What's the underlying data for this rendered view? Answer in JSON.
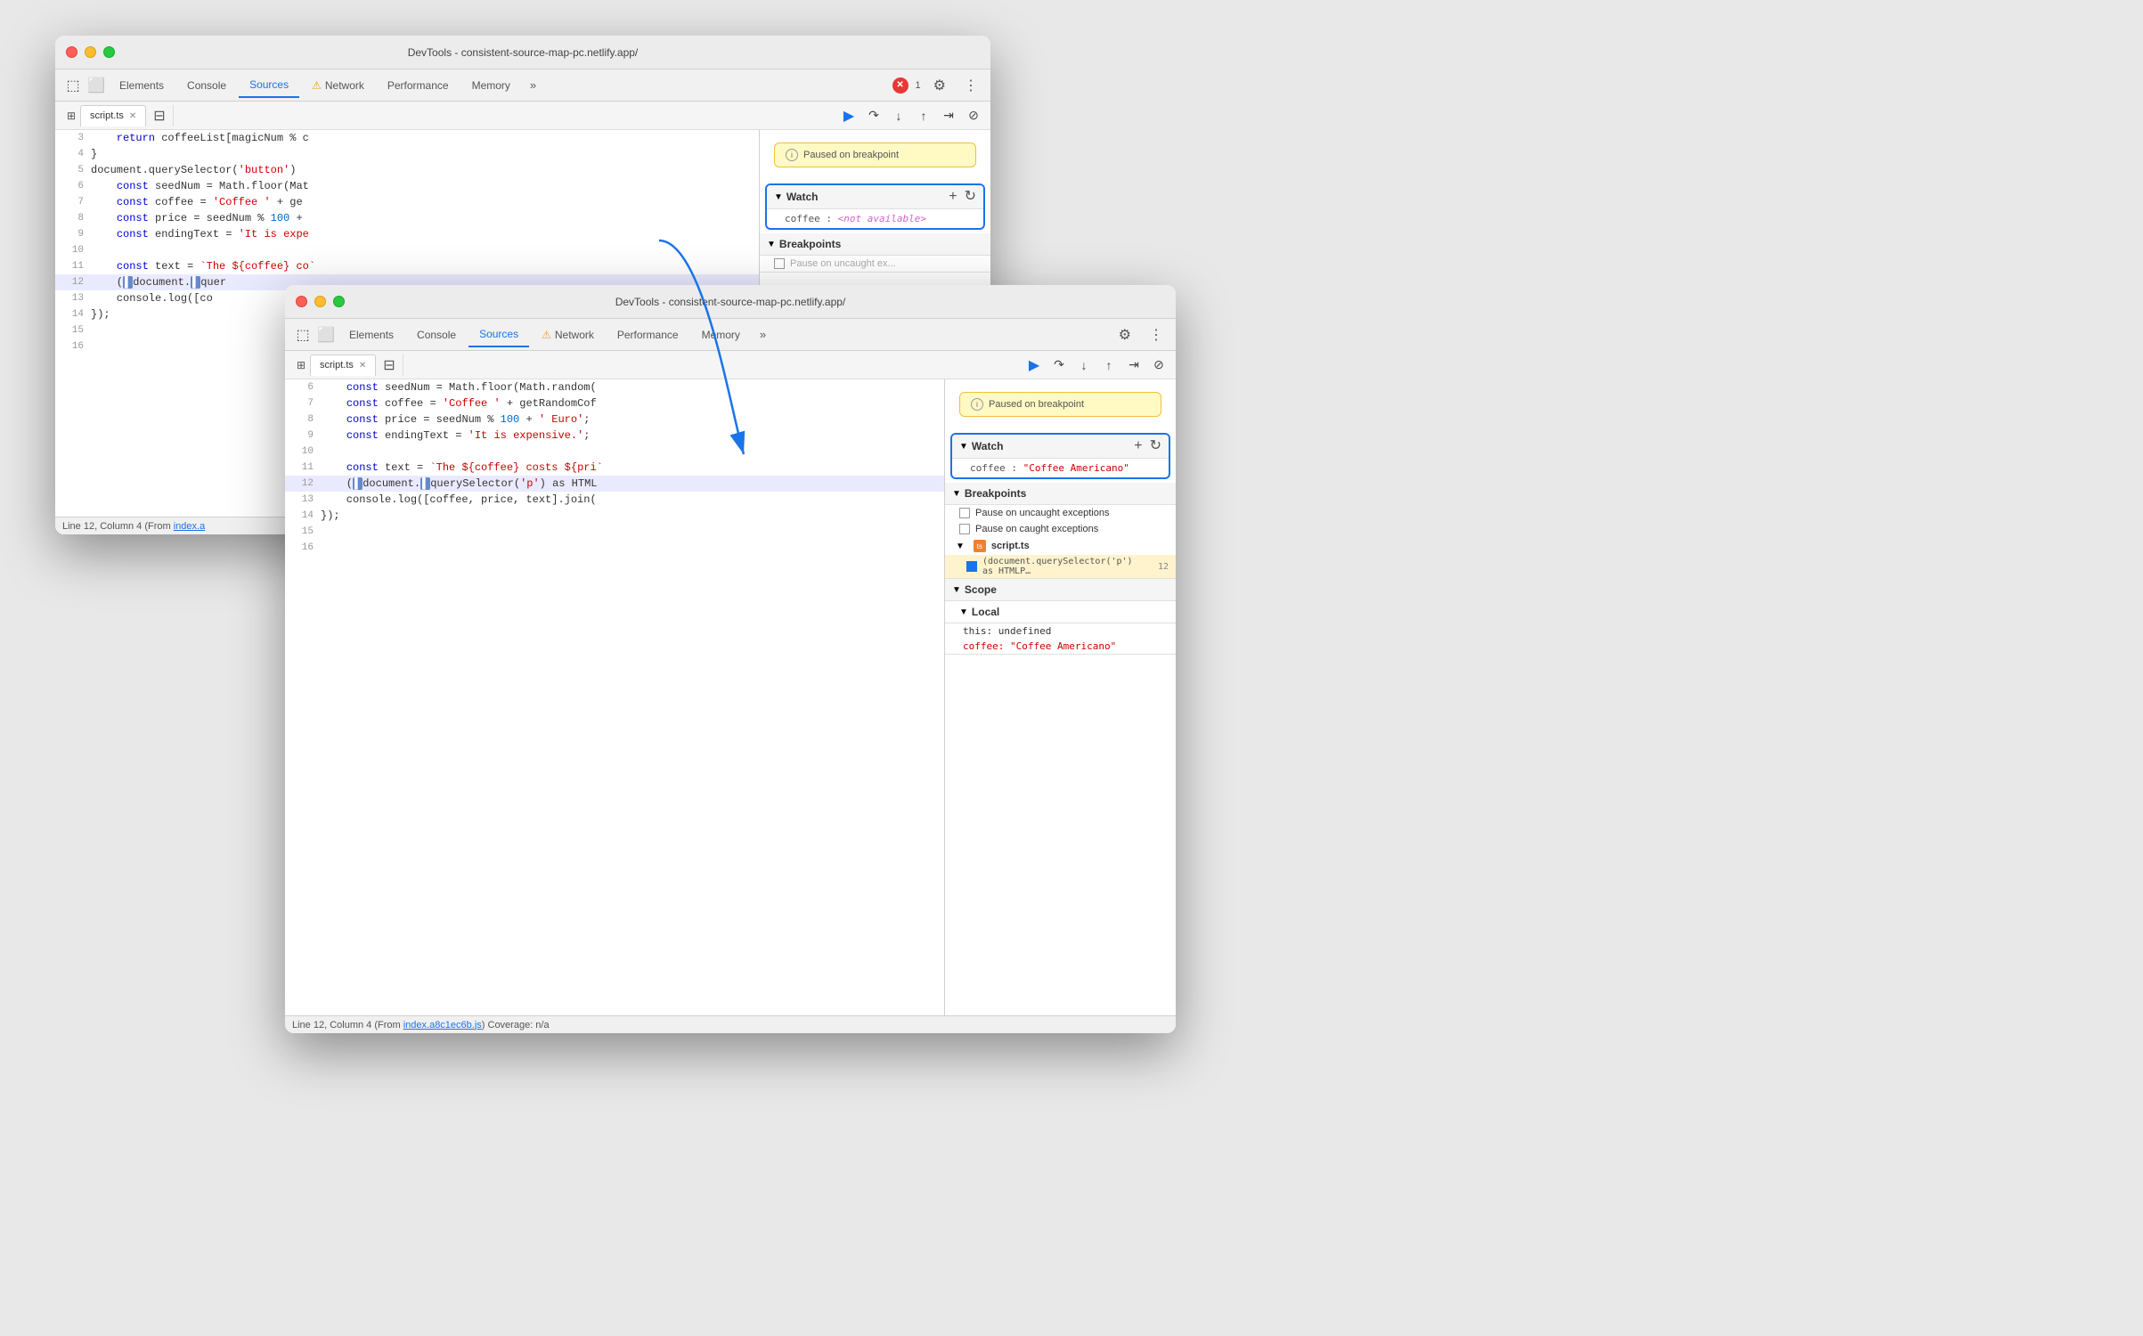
{
  "window1": {
    "title": "DevTools - consistent-source-map-pc.netlify.app/",
    "tabs": [
      "Elements",
      "Console",
      "Sources",
      "Network",
      "Performance",
      "Memory"
    ],
    "active_tab": "Sources",
    "network_warning": true,
    "error_count": 1,
    "file_tab": "script.ts",
    "code_lines": [
      {
        "num": 3,
        "content": "    return coffeeList[magicNum % c"
      },
      {
        "num": 4,
        "content": "}"
      },
      {
        "num": 5,
        "content": "document.querySelector('button')"
      },
      {
        "num": 6,
        "content": "    const seedNum = Math.floor(Mat"
      },
      {
        "num": 7,
        "content": "    const coffee = 'Coffee ' + ge"
      },
      {
        "num": 8,
        "content": "    const price = seedNum % 100 +"
      },
      {
        "num": 9,
        "content": "    const endingText = 'It is expe"
      },
      {
        "num": 10,
        "content": ""
      },
      {
        "num": 11,
        "content": "    const text = `The ${coffee} co`"
      },
      {
        "num": 12,
        "content": "    (document.querySelector",
        "active": true
      },
      {
        "num": 13,
        "content": "    console.log([co"
      },
      {
        "num": 14,
        "content": "});"
      },
      {
        "num": 15,
        "content": ""
      },
      {
        "num": 16,
        "content": ""
      }
    ],
    "status_bar": "Line 12, Column 4 (From index.a",
    "paused_banner": "Paused on breakpoint",
    "watch": {
      "title": "Watch",
      "entry_key": "coffee",
      "entry_value": "<not available>",
      "value_type": "unavailable"
    },
    "breakpoints": {
      "title": "Breakpoints"
    }
  },
  "window2": {
    "title": "DevTools - consistent-source-map-pc.netlify.app/",
    "tabs": [
      "Elements",
      "Console",
      "Sources",
      "Network",
      "Performance",
      "Memory"
    ],
    "active_tab": "Sources",
    "network_warning": true,
    "file_tab": "script.ts",
    "code_lines": [
      {
        "num": 6,
        "content": "    const seedNum = Math.floor(Math.random("
      },
      {
        "num": 7,
        "content": "    const coffee = 'Coffee ' + getRandomCof"
      },
      {
        "num": 8,
        "content": "    const price = seedNum % 100 + ' Euro';"
      },
      {
        "num": 9,
        "content": "    const endingText = 'It is expensive.';"
      },
      {
        "num": 10,
        "content": ""
      },
      {
        "num": 11,
        "content": "    const text = `The ${coffee} costs ${pri`"
      },
      {
        "num": 12,
        "content": "    (document.querySelector('p') as HTML",
        "active": true
      },
      {
        "num": 13,
        "content": "    console.log([coffee, price, text].join("
      },
      {
        "num": 14,
        "content": "});"
      },
      {
        "num": 15,
        "content": ""
      },
      {
        "num": 16,
        "content": ""
      }
    ],
    "status_bar": "Line 12, Column 4  (From index.a8c1ec6b.js) Coverage: n/a",
    "paused_banner": "Paused on breakpoint",
    "watch": {
      "title": "Watch",
      "entry_key": "coffee",
      "entry_value": "\"Coffee Americano\"",
      "value_type": "string"
    },
    "breakpoints": {
      "title": "Breakpoints",
      "pause_uncaught": "Pause on uncaught exceptions",
      "pause_caught": "Pause on caught exceptions",
      "file": "script.ts",
      "bp_line_content": "(document.querySelector('p') as HTMLP…",
      "bp_line_num": "12"
    },
    "scope": {
      "title": "Scope",
      "local_title": "Local",
      "this_entry": "this: undefined",
      "coffee_entry": "coffee: \"Coffee Americano\""
    }
  },
  "icons": {
    "close": "✕",
    "settings": "⚙",
    "more": "⋮",
    "more_tabs": "»",
    "add": "+",
    "refresh": "↻",
    "chevron_right": "▶",
    "chevron_down": "▼",
    "info": "i",
    "sidebar_toggle": "⊞",
    "panel_layout": "⊟",
    "step_over": "↷",
    "step_into": "↓",
    "step_out": "↑",
    "continue": "▶",
    "step_long": "⇥",
    "deactivate": "⊘",
    "resume": "▷",
    "file_icon": "ts"
  },
  "arrow": {
    "label": "Arrow from window1 watch to window2 watch"
  }
}
